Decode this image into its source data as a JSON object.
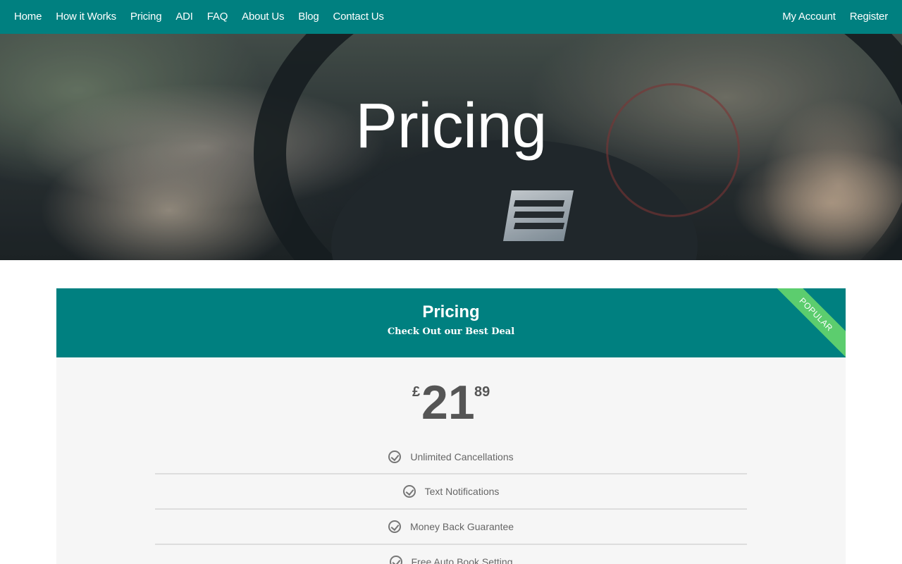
{
  "nav": {
    "left": [
      {
        "label": "Home"
      },
      {
        "label": "How it Works"
      },
      {
        "label": "Pricing"
      },
      {
        "label": "ADI"
      },
      {
        "label": "FAQ"
      },
      {
        "label": "About Us"
      },
      {
        "label": "Blog"
      },
      {
        "label": "Contact Us"
      }
    ],
    "right": [
      {
        "label": "My Account"
      },
      {
        "label": "Register"
      }
    ],
    "bg_color": "#008080"
  },
  "hero": {
    "title": "Pricing"
  },
  "pricing_card": {
    "title": "Pricing",
    "subtitle": "Check Out our Best Deal",
    "ribbon": "POPULAR",
    "price": {
      "currency": "£",
      "amount": "21",
      "cents": "89"
    },
    "features": [
      {
        "label": "Unlimited Cancellations",
        "icon": "check-circle-icon"
      },
      {
        "label": "Text Notifications",
        "icon": "check-circle-icon"
      },
      {
        "label": "Money Back Guarantee",
        "icon": "check-circle-icon"
      },
      {
        "label": "Free Auto Book Setting",
        "icon": "check-circle-icon"
      }
    ],
    "header_color": "#008080",
    "ribbon_color": "#5ccd6e"
  }
}
